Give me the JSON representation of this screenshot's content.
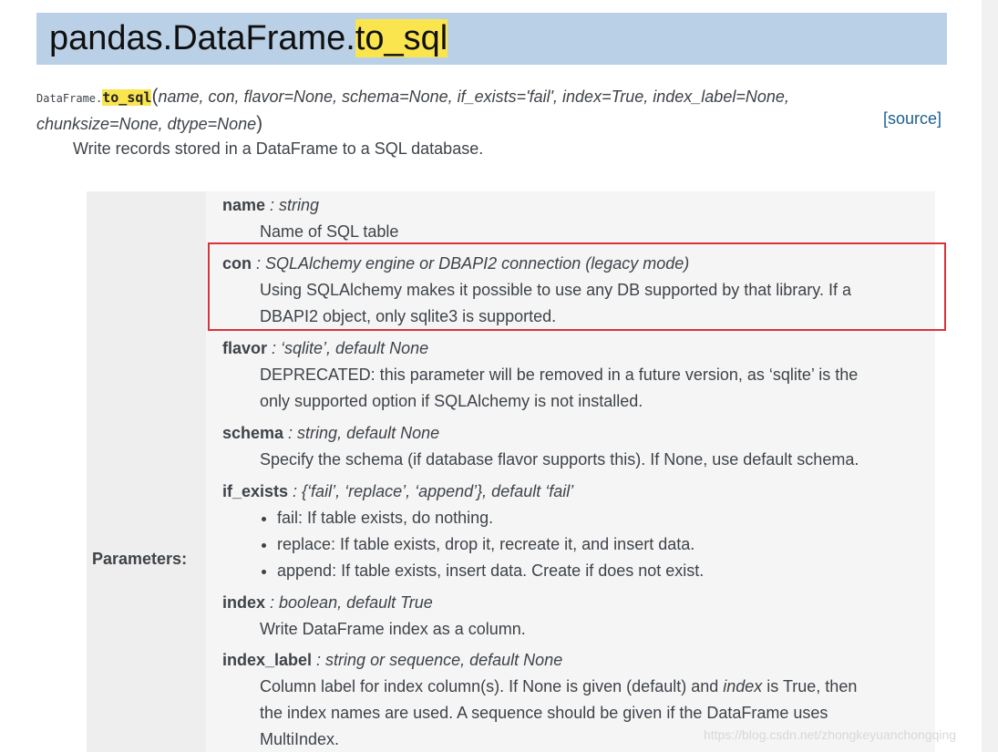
{
  "header": {
    "title_prefix": "pandas.DataFrame.",
    "title_highlight": "to_sql"
  },
  "signature": {
    "class_name": "DataFrame.",
    "function_name": "to_sql",
    "open_paren": "(",
    "close_paren": ")",
    "args_line1": "name, con, flavor=None, schema=None, if_exists='fail', index=True, index_label=None,",
    "args_line2": "chunksize=None, dtype=None",
    "source_link": "[source]"
  },
  "summary": "Write records stored in a DataFrame to a SQL database.",
  "field_list": {
    "label": "Parameters:",
    "params": [
      {
        "name": "name",
        "type": " : string",
        "desc": [
          "Name of SQL table"
        ]
      },
      {
        "name": "con",
        "type": " : SQLAlchemy engine or DBAPI2 connection (legacy mode)",
        "desc": [
          "Using SQLAlchemy makes it possible to use any DB supported by that library. If a",
          "DBAPI2 object, only sqlite3 is supported."
        ]
      },
      {
        "name": "flavor",
        "type": " : ‘sqlite’, default None",
        "desc": [
          "DEPRECATED: this parameter will be removed in a future version, as ‘sqlite’ is the",
          "only supported option if SQLAlchemy is not installed."
        ]
      },
      {
        "name": "schema",
        "type": " : string, default None",
        "desc": [
          "Specify the schema (if database flavor supports this). If None, use default schema."
        ]
      },
      {
        "name": "if_exists",
        "type": " : {‘fail’, ‘replace’, ‘append’}, default ‘fail’",
        "bullets": [
          "fail: If table exists, do nothing.",
          "replace: If table exists, drop it, recreate it, and insert data.",
          "append: If table exists, insert data. Create if does not exist."
        ]
      },
      {
        "name": "index",
        "type": " : boolean, default True",
        "desc": [
          "Write DataFrame index as a column."
        ]
      },
      {
        "name": "index_label",
        "type": " : string or sequence, default None",
        "desc_parts": {
          "line1_a": "Column label for index column(s). If None is given (default) and ",
          "line1_em": "index",
          "line1_b": " is True, then",
          "line2": "the index names are used. A sequence should be given if the DataFrame uses",
          "line3": "MultiIndex."
        }
      }
    ]
  },
  "watermark": "https://blog.csdn.net/zhongkeyuanchongqing",
  "colors": {
    "title_bar": "#bad0e6",
    "highlight": "#fbe54e",
    "annotation_box": "#d9343a",
    "link": "#1d5f8c"
  }
}
